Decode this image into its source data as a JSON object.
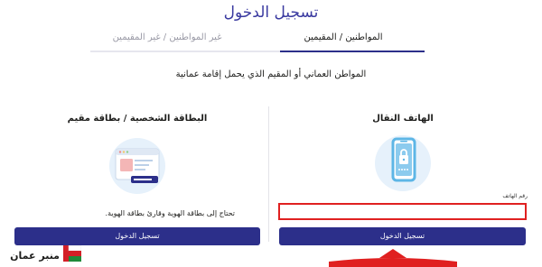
{
  "page": {
    "title": "تسجيل الدخول"
  },
  "tabs": {
    "citizens": "المواطنين / المقيمين",
    "noncitizens": "غير المواطنين / غير المقيمين"
  },
  "subtitle": "المواطن العماني أو المقيم الذي يحمل إقامة عمانية",
  "phone_section": {
    "title": "الهاتف النقال",
    "field_label": "رقم الهاتف",
    "field_value": "",
    "field_placeholder": "",
    "button_label": "تسجيل الدخول"
  },
  "card_section": {
    "title": "البطاقة الشخصية / بطاقة مقيم",
    "note": "تحتاج إلى بطاقة الهوية وقارئ بطاقة الهوية.",
    "button_label": "تسجيل الدخول"
  },
  "watermark": {
    "text": "منبر عمان"
  },
  "colors": {
    "brand": "#2c2f8a",
    "title": "#3a3aa0",
    "highlight_border": "#e02020",
    "illustration_bg": "#e6f1fb"
  },
  "icons": {
    "phone_illustration": "smartphone-lock-icon",
    "card_illustration": "id-card-reader-icon",
    "arrow": "red-arrow-icon",
    "logo": "oman-flag-logo-icon"
  }
}
